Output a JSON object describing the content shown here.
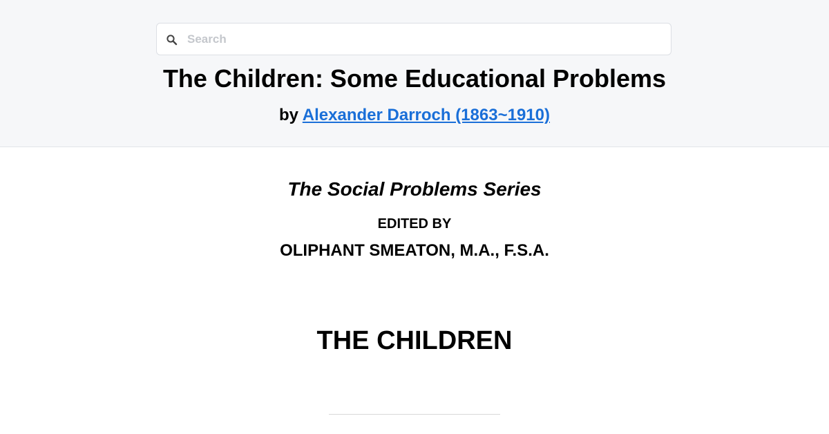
{
  "search": {
    "placeholder": "Search",
    "icon": "search-icon"
  },
  "book": {
    "title": "The Children: Some Educational Problems",
    "by_prefix": "by",
    "author_link": "Alexander Darroch (1863~1910)"
  },
  "content": {
    "series": "The Social Problems Series",
    "edited_by": "EDITED BY",
    "editor": "OLIPHANT SMEATON, M.A., F.S.A.",
    "heading": "THE CHILDREN"
  },
  "colors": {
    "header_bg": "#f6f7f9",
    "link": "#1a6fd8"
  }
}
